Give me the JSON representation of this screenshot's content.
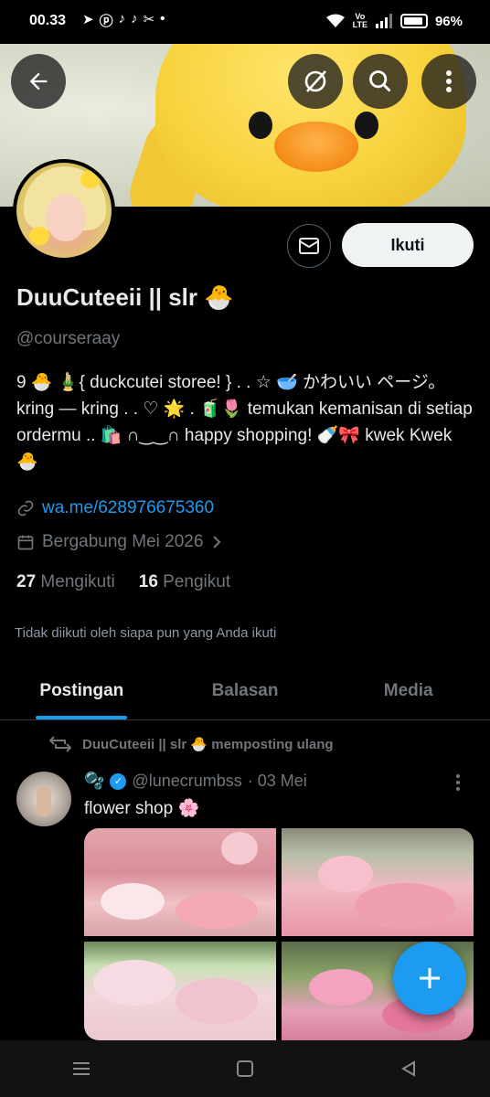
{
  "status_bar": {
    "time": "00.33",
    "volte_top": "Vo",
    "volte_bottom": "LTE",
    "battery": "96%"
  },
  "profile": {
    "display_name": "DuuCuteeii || slr 🐣",
    "handle": "@courseraay",
    "bio": "9 🐣 🎍{ duckcutei storee! } . . ☆ 🥣 かわいい ページ。kring — kring . . ♡ 🌟 . 🧃🌷 temukan kemanisan di setiap ordermu .. 🛍️ ∩‿‿∩ happy shopping! 🍼🎀 kwek Kwek 🐣",
    "link": "wa.me/628976675360",
    "joined": "Bergabung Mei 2026",
    "following_count": "27",
    "following_label": "Mengikuti",
    "followers_count": "16",
    "followers_label": "Pengikut",
    "not_followed_note": "Tidak diikuti oleh siapa pun yang Anda ikuti",
    "follow_button": "Ikuti"
  },
  "tabs": [
    {
      "label": "Postingan",
      "active": true
    },
    {
      "label": "Balasan",
      "active": false
    },
    {
      "label": "Media",
      "active": false
    }
  ],
  "post": {
    "repost_text": "DuuCuteeii || slr 🐣 memposting ulang",
    "author_prefix": "🫧",
    "author_handle": "@lunecrumbss",
    "date": "· 03 Mei",
    "text": "flower shop 🌸"
  },
  "icons": {
    "back": "back-arrow-icon",
    "block": "ban-icon",
    "search": "search-icon",
    "more": "more-vertical-icon",
    "mail": "mail-icon",
    "link": "link-icon",
    "calendar": "calendar-icon",
    "repost": "repost-icon",
    "compose": "plus-icon"
  },
  "colors": {
    "accent": "#1d9bf0",
    "background": "#000000",
    "text_primary": "#e7e9ea",
    "text_secondary": "#71767b"
  }
}
